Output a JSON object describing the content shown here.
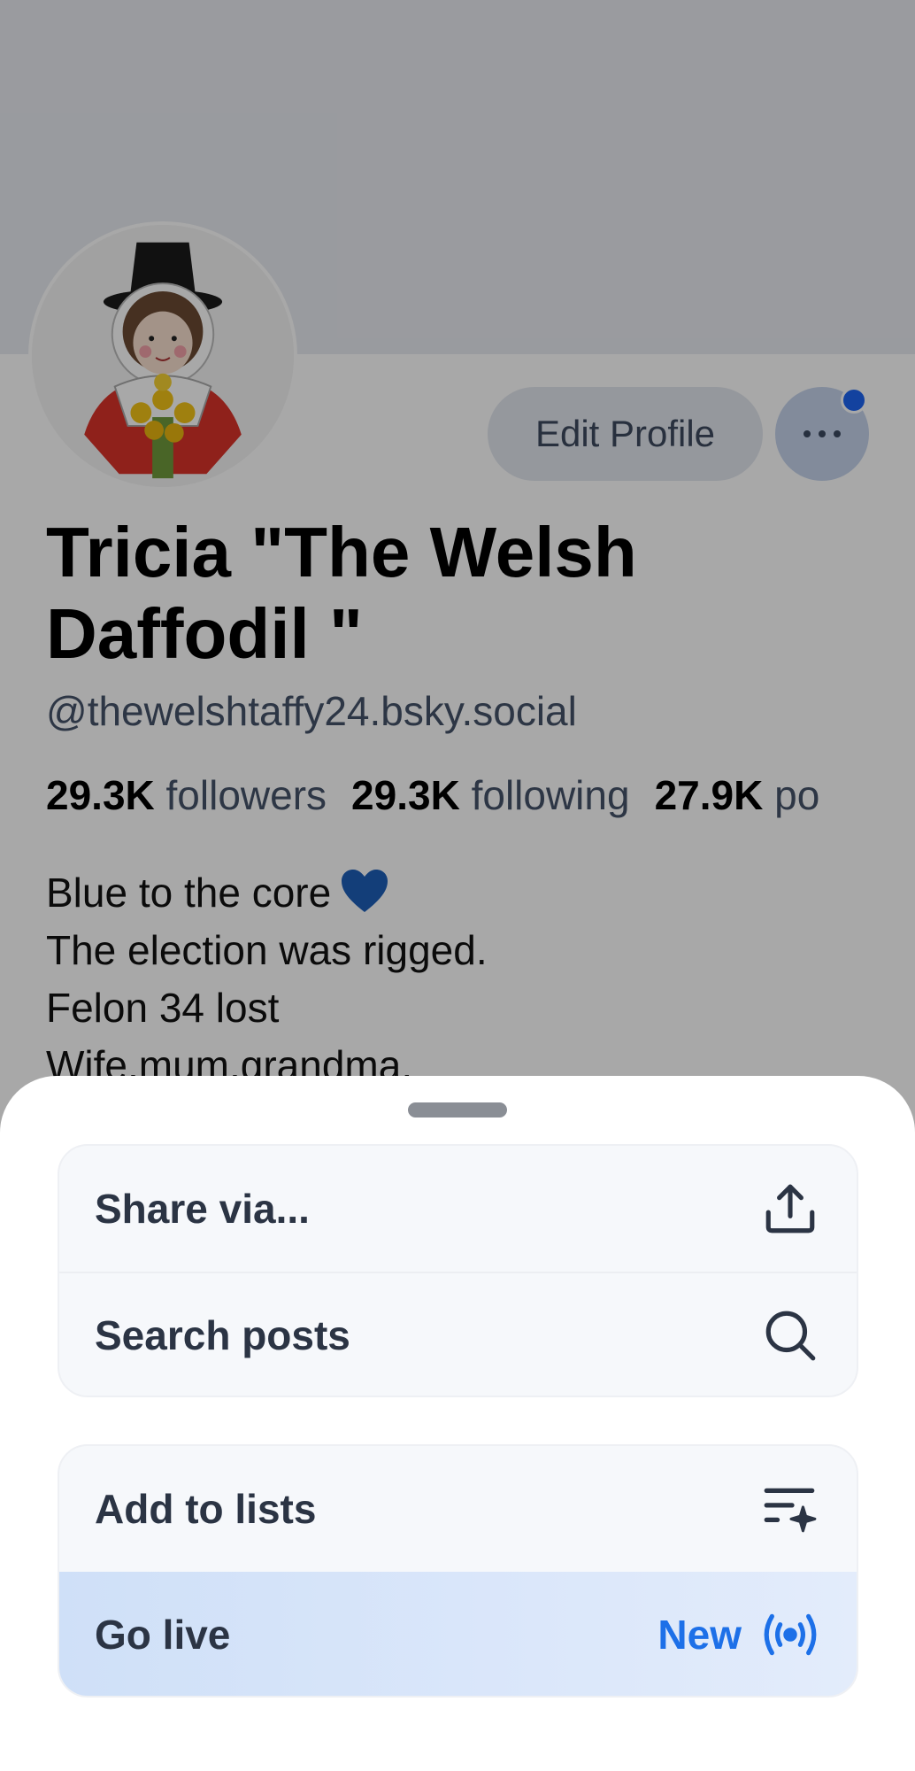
{
  "profile": {
    "display_name": "Tricia \"The Welsh Daffodil \"",
    "handle": "@thewelshtaffy24.bsky.social",
    "edit_button": "Edit Profile",
    "stats": {
      "followers_count": "29.3K",
      "followers_label": "followers",
      "following_count": "29.3K",
      "following_label": "following",
      "posts_count": "27.9K",
      "posts_label": "po"
    },
    "bio": {
      "line1": "Blue to the core",
      "line2": "The election was rigged.",
      "line3": "Felon 34 lost",
      "line4": "Wife,mum,grandma,"
    }
  },
  "sheet": {
    "menu_group1": [
      {
        "label": "Share via...",
        "icon": "share-icon"
      },
      {
        "label": "Search posts",
        "icon": "search-icon"
      }
    ],
    "menu_group2": [
      {
        "label": "Add to lists",
        "icon": "list-sparkle-icon"
      },
      {
        "label": "Go live",
        "badge": "New",
        "icon": "live-broadcast-icon"
      }
    ]
  },
  "colors": {
    "accent": "#1d70e8",
    "notification_dot": "#1d64f1",
    "live_row_bg": "#d6e4f9"
  }
}
